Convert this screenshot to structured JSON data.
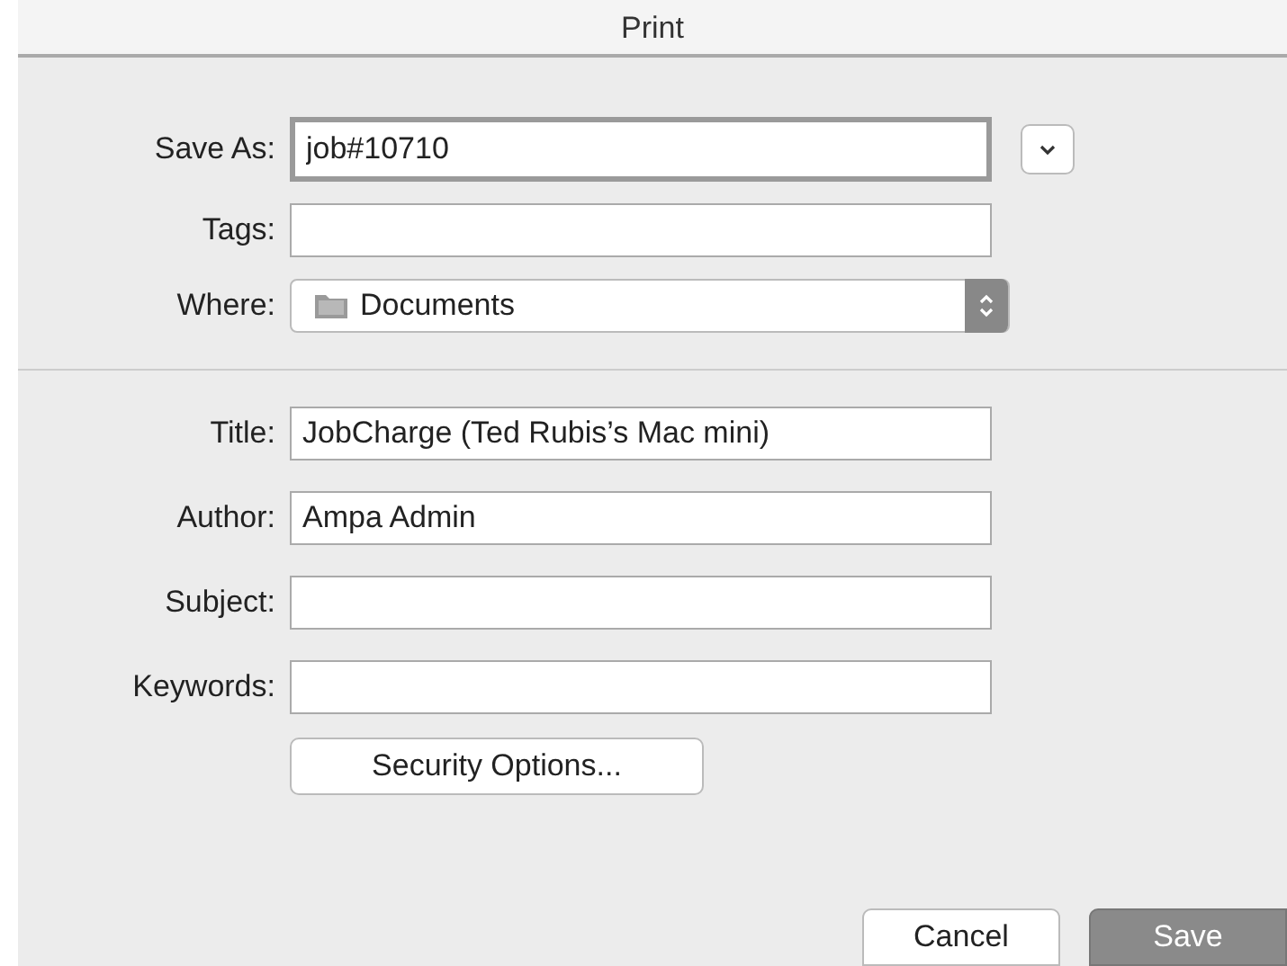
{
  "window": {
    "title": "Print"
  },
  "save_as": {
    "label": "Save As:",
    "value": "job#10710",
    "focused": true
  },
  "tags": {
    "label": "Tags:"
  },
  "where": {
    "label": "Where:",
    "value": "Documents"
  },
  "fields": [
    {
      "label": "Title:",
      "value": "JobCharge (Ted Rubis’s Mac mini)"
    },
    {
      "label": "Author:",
      "value": "Ampa Admin"
    },
    {
      "label": "Subject:"
    },
    {
      "label": "Keywords:"
    }
  ],
  "security_button": "Security Options...",
  "buttons": [
    {
      "label": "Cancel",
      "default": false
    },
    {
      "label": "Save",
      "default": true
    }
  ]
}
